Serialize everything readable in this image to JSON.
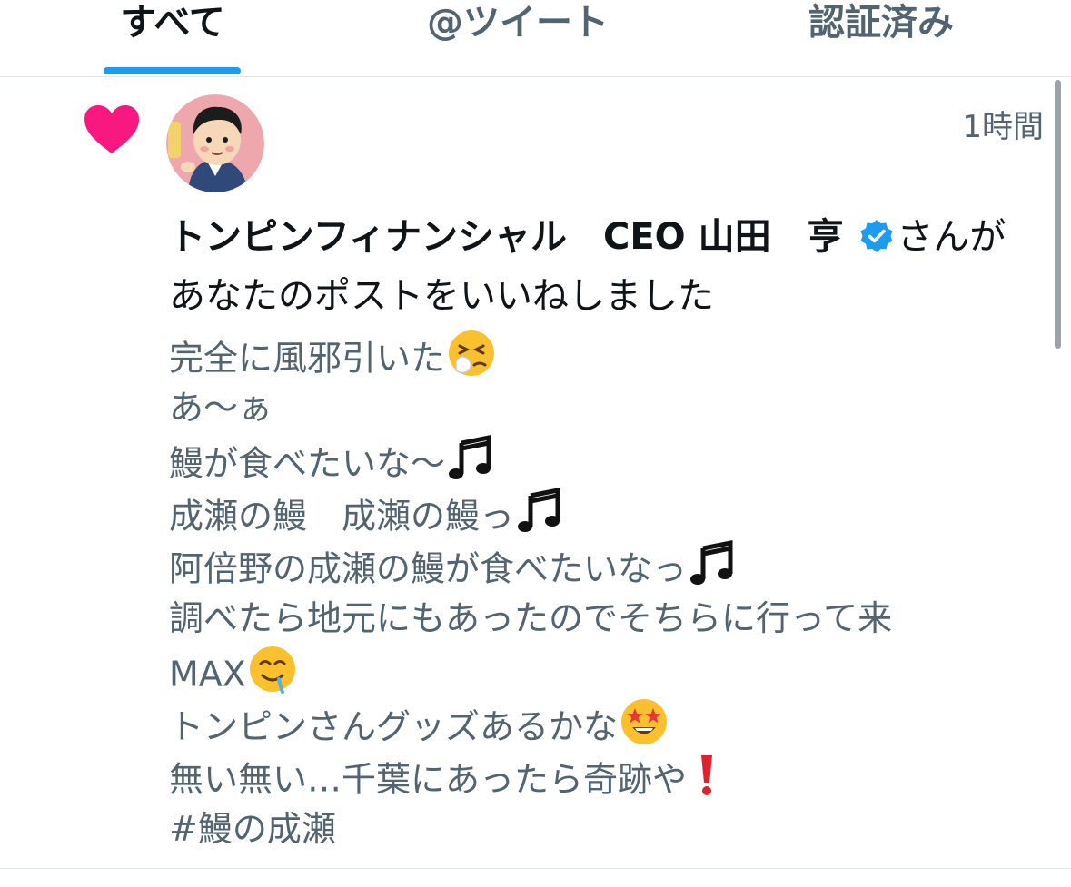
{
  "tabs": [
    {
      "label": "すべて",
      "active": true
    },
    {
      "label": "@ツイート",
      "active": false
    },
    {
      "label": "認証済み",
      "active": false
    }
  ],
  "colors": {
    "accent": "#1d9bf0",
    "heart": "#f91880",
    "text_primary": "#0f1419",
    "text_secondary": "#536471"
  },
  "notification": {
    "icon": "heart-icon",
    "time": "1時間",
    "user_name": "トンピンフィナンシャル　CEO 山田　亨",
    "verified": true,
    "action_text_1": "さんが",
    "action_text_2": "あなたのポストをいいねしました",
    "post_lines": [
      {
        "text": "完全に風邪引いた",
        "emoji": "sneezing-face-emoji"
      },
      {
        "text": "あ〜ぁ",
        "emoji": ""
      },
      {
        "text": "鰻が食べたいな〜",
        "emoji": "musical-notes-emoji"
      },
      {
        "text": "成瀬の鰻　成瀬の鰻っ",
        "emoji": "musical-notes-emoji"
      },
      {
        "text": "阿倍野の成瀬の鰻が食べたいなっ",
        "emoji": "musical-notes-emoji"
      },
      {
        "text": "調べたら地元にもあったのでそちらに行って来",
        "emoji": ""
      },
      {
        "text": " MAX",
        "emoji": "drooling-face-emoji"
      },
      {
        "text": "トンピンさんグッズあるかな",
        "emoji": "star-struck-emoji"
      },
      {
        "text": "無い無い…千葉にあったら奇跡や",
        "emoji": "exclamation-emoji"
      },
      {
        "text": "#鰻の成瀬",
        "emoji": ""
      }
    ]
  }
}
